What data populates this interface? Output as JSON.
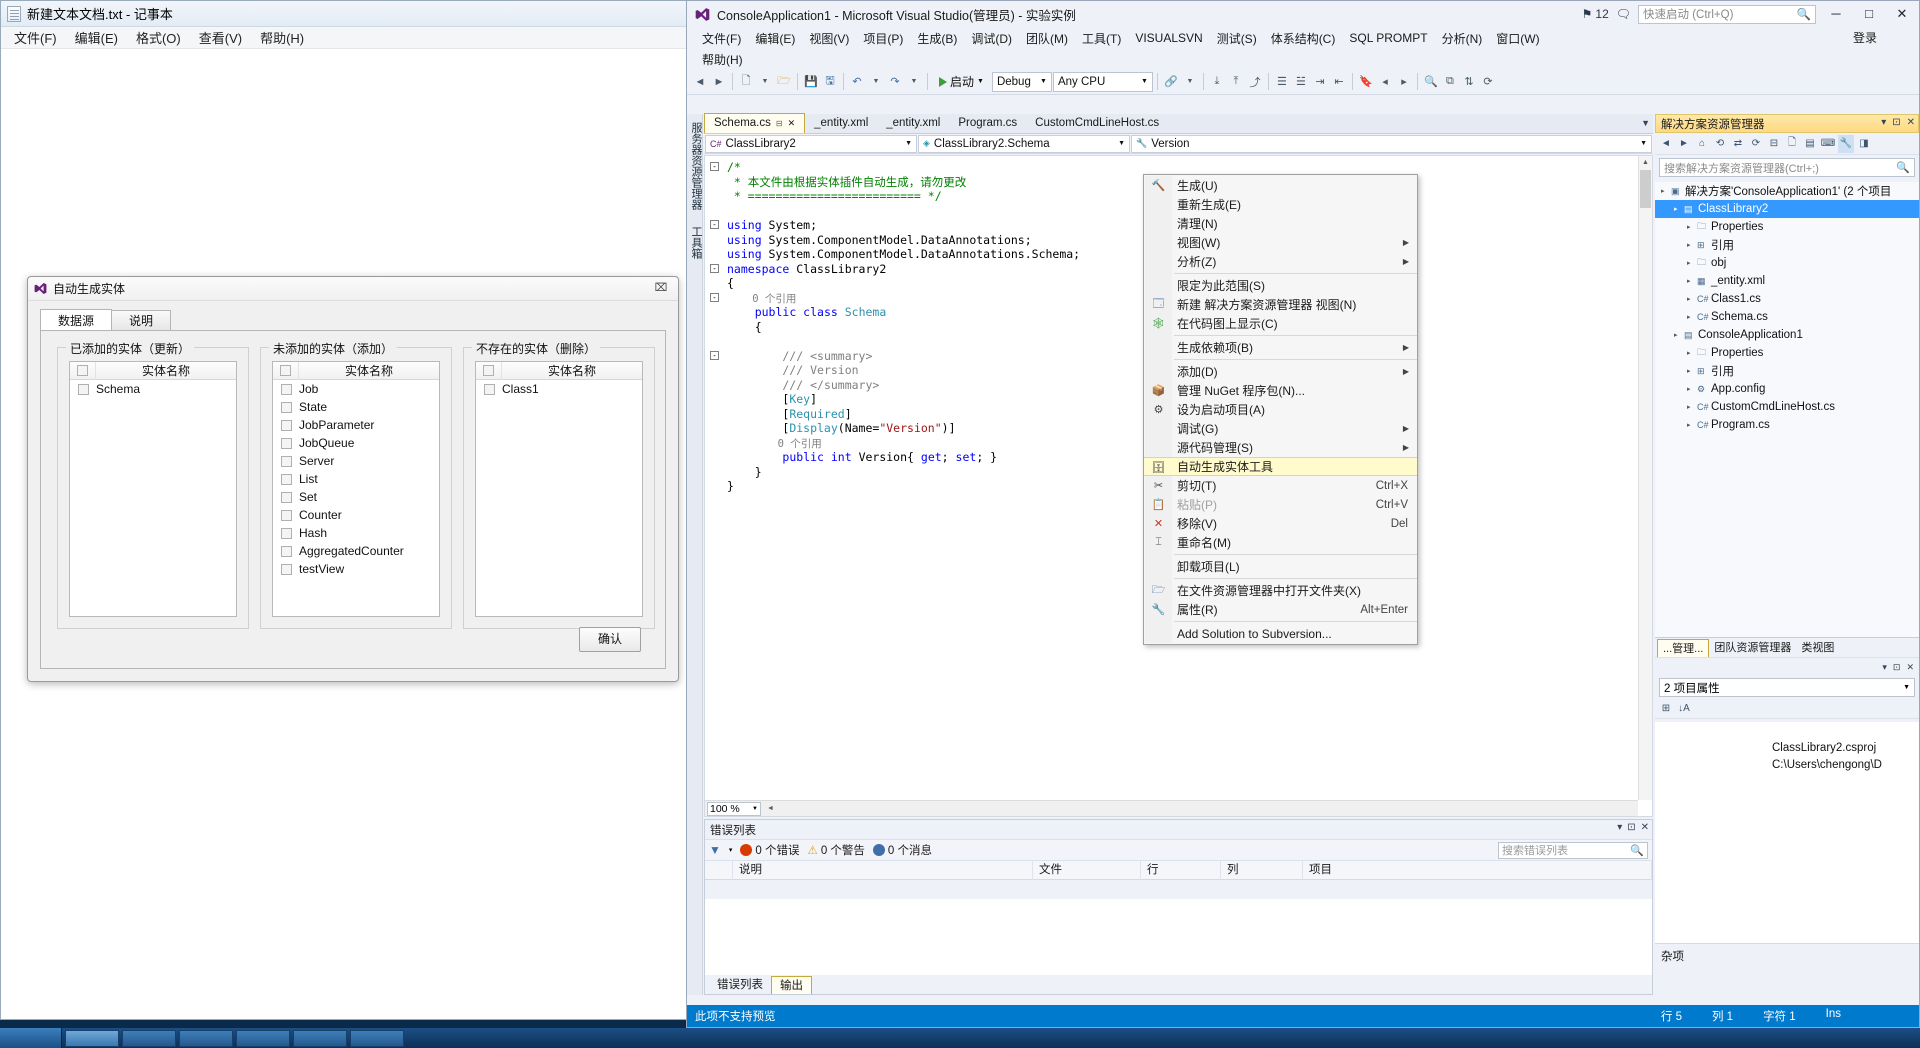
{
  "notepad": {
    "title": "新建文本文档.txt - 记事本",
    "icon": "notepad-icon",
    "menus": [
      "文件(F)",
      "编辑(E)",
      "格式(O)",
      "查看(V)",
      "帮助(H)"
    ]
  },
  "dialog": {
    "title": "自动生成实体",
    "icon": "visual-studio-icon",
    "close_label": "⌧",
    "tabs": [
      {
        "label": "数据源",
        "active": true
      },
      {
        "label": "说明",
        "active": false
      }
    ],
    "column_header": "实体名称",
    "groups": [
      {
        "title": "已添加的实体（更新）",
        "items": [
          "Schema"
        ]
      },
      {
        "title": "未添加的实体（添加）",
        "items": [
          "Job",
          "State",
          "JobParameter",
          "JobQueue",
          "Server",
          "List",
          "Set",
          "Counter",
          "Hash",
          "AggregatedCounter",
          "testView"
        ]
      },
      {
        "title": "不存在的实体（删除）",
        "items": [
          "Class1"
        ]
      }
    ],
    "confirm_label": "确认"
  },
  "vs": {
    "title": "ConsoleApplication1 - Microsoft Visual Studio(管理员) - 实验实例",
    "notification_count": "12",
    "quick_launch_placeholder": "快速启动 (Ctrl+Q)",
    "login_label": "登录",
    "window_buttons": {
      "minimize": "─",
      "maximize": "□",
      "close": "✕"
    },
    "menus_row1": [
      "文件(F)",
      "编辑(E)",
      "视图(V)",
      "项目(P)",
      "生成(B)",
      "调试(D)",
      "团队(M)",
      "工具(T)",
      "VISUALSVN",
      "测试(S)",
      "体系结构(C)",
      "SQL PROMPT",
      "分析(N)",
      "窗口(W)"
    ],
    "menus_row2": [
      "帮助(H)"
    ],
    "toolbar": {
      "start_label": "启动",
      "config": "Debug",
      "platform": "Any CPU"
    },
    "left_strips": [
      "服务器资源管理器",
      "工具箱"
    ],
    "doc_tabs": [
      {
        "label": "Schema.cs",
        "active": true,
        "pin": "📌",
        "close": "✕"
      },
      {
        "label": "_entity.xml",
        "active": false
      },
      {
        "label": "_entity.xml",
        "active": false
      },
      {
        "label": "Program.cs",
        "active": false
      },
      {
        "label": "CustomCmdLineHost.cs",
        "active": false
      }
    ],
    "nav_bar": {
      "project": "ClassLibrary2",
      "project_icon": "csharp-icon",
      "type": "ClassLibrary2.Schema",
      "type_icon": "class-icon",
      "member": "Version",
      "member_icon": "property-icon"
    },
    "code_lines": [
      {
        "fold": "-",
        "segs": [
          {
            "t": "/*",
            "c": "cmt"
          }
        ]
      },
      {
        "fold": "",
        "segs": [
          {
            "t": " * 本文件由根据实体插件自动生成，请勿更改",
            "c": "cmt"
          }
        ]
      },
      {
        "fold": "",
        "segs": [
          {
            "t": " * ========================= */",
            "c": "cmt"
          }
        ]
      },
      {
        "fold": "",
        "segs": [
          {
            "t": "",
            "c": ""
          }
        ]
      },
      {
        "fold": "-",
        "segs": [
          {
            "t": "using",
            "c": "kw"
          },
          {
            "t": " System;",
            "c": ""
          }
        ]
      },
      {
        "fold": "",
        "segs": [
          {
            "t": "using",
            "c": "kw"
          },
          {
            "t": " System.ComponentModel.DataAnnotations;",
            "c": ""
          }
        ]
      },
      {
        "fold": "",
        "segs": [
          {
            "t": "using",
            "c": "kw"
          },
          {
            "t": " System.ComponentModel.DataAnnotations.Schema;",
            "c": ""
          }
        ]
      },
      {
        "fold": "-",
        "segs": [
          {
            "t": "namespace",
            "c": "kw"
          },
          {
            "t": " ClassLibrary2",
            "c": ""
          }
        ]
      },
      {
        "fold": "",
        "segs": [
          {
            "t": "{",
            "c": ""
          }
        ]
      },
      {
        "fold": "-",
        "segs": [
          {
            "t": "    0 个引用",
            "c": "ref"
          }
        ]
      },
      {
        "fold": "",
        "segs": [
          {
            "t": "    ",
            "c": ""
          },
          {
            "t": "public class",
            "c": "kw"
          },
          {
            "t": " ",
            "c": ""
          },
          {
            "t": "Schema",
            "c": "typ"
          }
        ]
      },
      {
        "fold": "",
        "segs": [
          {
            "t": "    {",
            "c": ""
          }
        ]
      },
      {
        "fold": "",
        "segs": [
          {
            "t": "",
            "c": ""
          }
        ]
      },
      {
        "fold": "-",
        "segs": [
          {
            "t": "        /// ",
            "c": "doc"
          },
          {
            "t": "<summary>",
            "c": "xmltag"
          }
        ]
      },
      {
        "fold": "",
        "segs": [
          {
            "t": "        /// ",
            "c": "doc"
          },
          {
            "t": "Version",
            "c": "doc"
          }
        ]
      },
      {
        "fold": "",
        "segs": [
          {
            "t": "        /// ",
            "c": "doc"
          },
          {
            "t": "</summary>",
            "c": "xmltag"
          }
        ]
      },
      {
        "fold": "",
        "segs": [
          {
            "t": "        [",
            "c": ""
          },
          {
            "t": "Key",
            "c": "typ"
          },
          {
            "t": "]",
            "c": ""
          }
        ]
      },
      {
        "fold": "",
        "segs": [
          {
            "t": "        [",
            "c": ""
          },
          {
            "t": "Required",
            "c": "typ"
          },
          {
            "t": "]",
            "c": ""
          }
        ]
      },
      {
        "fold": "",
        "segs": [
          {
            "t": "        [",
            "c": ""
          },
          {
            "t": "Display",
            "c": "typ"
          },
          {
            "t": "(Name=",
            "c": ""
          },
          {
            "t": "\"Version\"",
            "c": "str"
          },
          {
            "t": ")]",
            "c": ""
          }
        ]
      },
      {
        "fold": "",
        "segs": [
          {
            "t": "        0 个引用",
            "c": "ref"
          }
        ]
      },
      {
        "fold": "",
        "segs": [
          {
            "t": "        ",
            "c": ""
          },
          {
            "t": "public int",
            "c": "kw"
          },
          {
            "t": " Version{ ",
            "c": ""
          },
          {
            "t": "get",
            "c": "kw"
          },
          {
            "t": "; ",
            "c": ""
          },
          {
            "t": "set",
            "c": "kw"
          },
          {
            "t": "; }",
            "c": ""
          }
        ]
      },
      {
        "fold": "",
        "segs": [
          {
            "t": "    }",
            "c": ""
          }
        ]
      },
      {
        "fold": "",
        "segs": [
          {
            "t": "}",
            "c": ""
          }
        ]
      }
    ],
    "zoom_level": "100 %",
    "error_list": {
      "title": "错误列表",
      "errors": "0 个错误",
      "warnings": "0 个警告",
      "messages": "0 个消息",
      "search_placeholder": "搜索错误列表",
      "columns": [
        "",
        "说明",
        "文件",
        "行",
        "列",
        "项目"
      ],
      "tabs": [
        {
          "label": "错误列表",
          "active": false
        },
        {
          "label": "输出",
          "active": true
        }
      ]
    },
    "solution_explorer": {
      "title": "解决方案资源管理器",
      "search_placeholder": "搜索解决方案资源管理器(Ctrl+;)",
      "tree": [
        {
          "indent": 0,
          "label": "解决方案'ConsoleApplication1' (2 个项目",
          "icon": "solution-icon",
          "selected": false
        },
        {
          "indent": 1,
          "label": "ClassLibrary2",
          "icon": "project-icon",
          "selected": true
        },
        {
          "indent": 2,
          "label": "Properties",
          "icon": "folder-icon",
          "selected": false
        },
        {
          "indent": 2,
          "label": "引用",
          "icon": "references-icon",
          "selected": false
        },
        {
          "indent": 2,
          "label": "obj",
          "icon": "folder-icon",
          "selected": false
        },
        {
          "indent": 2,
          "label": "_entity.xml",
          "icon": "xml-icon",
          "selected": false
        },
        {
          "indent": 2,
          "label": "Class1.cs",
          "icon": "csfile-icon",
          "selected": false
        },
        {
          "indent": 2,
          "label": "Schema.cs",
          "icon": "csfile-icon",
          "selected": false
        },
        {
          "indent": 1,
          "label": "ConsoleApplication1",
          "icon": "project-icon",
          "selected": false
        },
        {
          "indent": 2,
          "label": "Properties",
          "icon": "folder-icon",
          "selected": false
        },
        {
          "indent": 2,
          "label": "引用",
          "icon": "references-icon",
          "selected": false
        },
        {
          "indent": 2,
          "label": "App.config",
          "icon": "config-icon",
          "selected": false
        },
        {
          "indent": 2,
          "label": "CustomCmdLineHost.cs",
          "icon": "csfile-icon",
          "selected": false
        },
        {
          "indent": 2,
          "label": "Program.cs",
          "icon": "csfile-icon",
          "selected": false
        }
      ],
      "bottom_tabs": [
        {
          "label": "...管理...",
          "active": true
        },
        {
          "label": "团队资源管理器",
          "active": false
        },
        {
          "label": "类视图",
          "active": false
        }
      ]
    },
    "properties": {
      "title": "2 项目属性",
      "rows": [
        {
          "key": "",
          "value": ""
        },
        {
          "key": "",
          "value": "ClassLibrary2.csproj"
        },
        {
          "key": "",
          "value": "C:\\Users\\chengong\\D"
        }
      ],
      "category": "杂项"
    },
    "status_bar": {
      "message": "此项不支持预览",
      "line": "行 5",
      "col": "列 1",
      "char": "字符 1",
      "insert_mode": "Ins"
    }
  },
  "context_menu": {
    "items": [
      {
        "label": "生成(U)",
        "icon": "build-icon",
        "accel": "",
        "submenu": false,
        "disabled": false,
        "highlighted": false,
        "sep_after": false
      },
      {
        "label": "重新生成(E)",
        "icon": "",
        "accel": "",
        "submenu": false,
        "disabled": false,
        "highlighted": false,
        "sep_after": false
      },
      {
        "label": "清理(N)",
        "icon": "",
        "accel": "",
        "submenu": false,
        "disabled": false,
        "highlighted": false,
        "sep_after": false
      },
      {
        "label": "视图(W)",
        "icon": "",
        "accel": "",
        "submenu": true,
        "disabled": false,
        "highlighted": false,
        "sep_after": false
      },
      {
        "label": "分析(Z)",
        "icon": "",
        "accel": "",
        "submenu": true,
        "disabled": false,
        "highlighted": false,
        "sep_after": true
      },
      {
        "label": "限定为此范围(S)",
        "icon": "",
        "accel": "",
        "submenu": false,
        "disabled": false,
        "highlighted": false,
        "sep_after": false
      },
      {
        "label": "新建 解决方案资源管理器 视图(N)",
        "icon": "new-view-icon",
        "accel": "",
        "submenu": false,
        "disabled": false,
        "highlighted": false,
        "sep_after": false
      },
      {
        "label": "在代码图上显示(C)",
        "icon": "code-map-icon",
        "accel": "",
        "submenu": false,
        "disabled": false,
        "highlighted": false,
        "sep_after": true
      },
      {
        "label": "生成依赖项(B)",
        "icon": "",
        "accel": "",
        "submenu": true,
        "disabled": false,
        "highlighted": false,
        "sep_after": true
      },
      {
        "label": "添加(D)",
        "icon": "",
        "accel": "",
        "submenu": true,
        "disabled": false,
        "highlighted": false,
        "sep_after": false
      },
      {
        "label": "管理 NuGet 程序包(N)...",
        "icon": "nuget-icon",
        "accel": "",
        "submenu": false,
        "disabled": false,
        "highlighted": false,
        "sep_after": false
      },
      {
        "label": "设为启动项目(A)",
        "icon": "gear-icon",
        "accel": "",
        "submenu": false,
        "disabled": false,
        "highlighted": false,
        "sep_after": false
      },
      {
        "label": "调试(G)",
        "icon": "",
        "accel": "",
        "submenu": true,
        "disabled": false,
        "highlighted": false,
        "sep_after": false
      },
      {
        "label": "源代码管理(S)",
        "icon": "",
        "accel": "",
        "submenu": true,
        "disabled": false,
        "highlighted": false,
        "sep_after": false
      },
      {
        "label": "自动生成实体工具",
        "icon": "database-icon",
        "accel": "",
        "submenu": false,
        "disabled": false,
        "highlighted": true,
        "sep_after": false
      },
      {
        "label": "剪切(T)",
        "icon": "scissors-icon",
        "accel": "Ctrl+X",
        "submenu": false,
        "disabled": false,
        "highlighted": false,
        "sep_after": false
      },
      {
        "label": "粘贴(P)",
        "icon": "paste-icon",
        "accel": "Ctrl+V",
        "submenu": false,
        "disabled": true,
        "highlighted": false,
        "sep_after": false
      },
      {
        "label": "移除(V)",
        "icon": "remove-icon",
        "accel": "Del",
        "submenu": false,
        "disabled": false,
        "highlighted": false,
        "sep_after": false
      },
      {
        "label": "重命名(M)",
        "icon": "rename-icon",
        "accel": "",
        "submenu": false,
        "disabled": false,
        "highlighted": false,
        "sep_after": true
      },
      {
        "label": "卸载项目(L)",
        "icon": "",
        "accel": "",
        "submenu": false,
        "disabled": false,
        "highlighted": false,
        "sep_after": true
      },
      {
        "label": "在文件资源管理器中打开文件夹(X)",
        "icon": "folder-open-icon",
        "accel": "",
        "submenu": false,
        "disabled": false,
        "highlighted": false,
        "sep_after": false
      },
      {
        "label": "属性(R)",
        "icon": "wrench-icon",
        "accel": "Alt+Enter",
        "submenu": false,
        "disabled": false,
        "highlighted": false,
        "sep_after": true
      },
      {
        "label": "Add Solution to Subversion...",
        "icon": "",
        "accel": "",
        "submenu": false,
        "disabled": false,
        "highlighted": false,
        "sep_after": false
      }
    ]
  },
  "taskbar": {
    "start_label": "",
    "items": 7
  },
  "colors": {
    "accent": "#007acc",
    "highlight": "#fffbcc",
    "selection": "#3399ff",
    "comment_green": "#008000",
    "keyword_blue": "#0000ff"
  }
}
